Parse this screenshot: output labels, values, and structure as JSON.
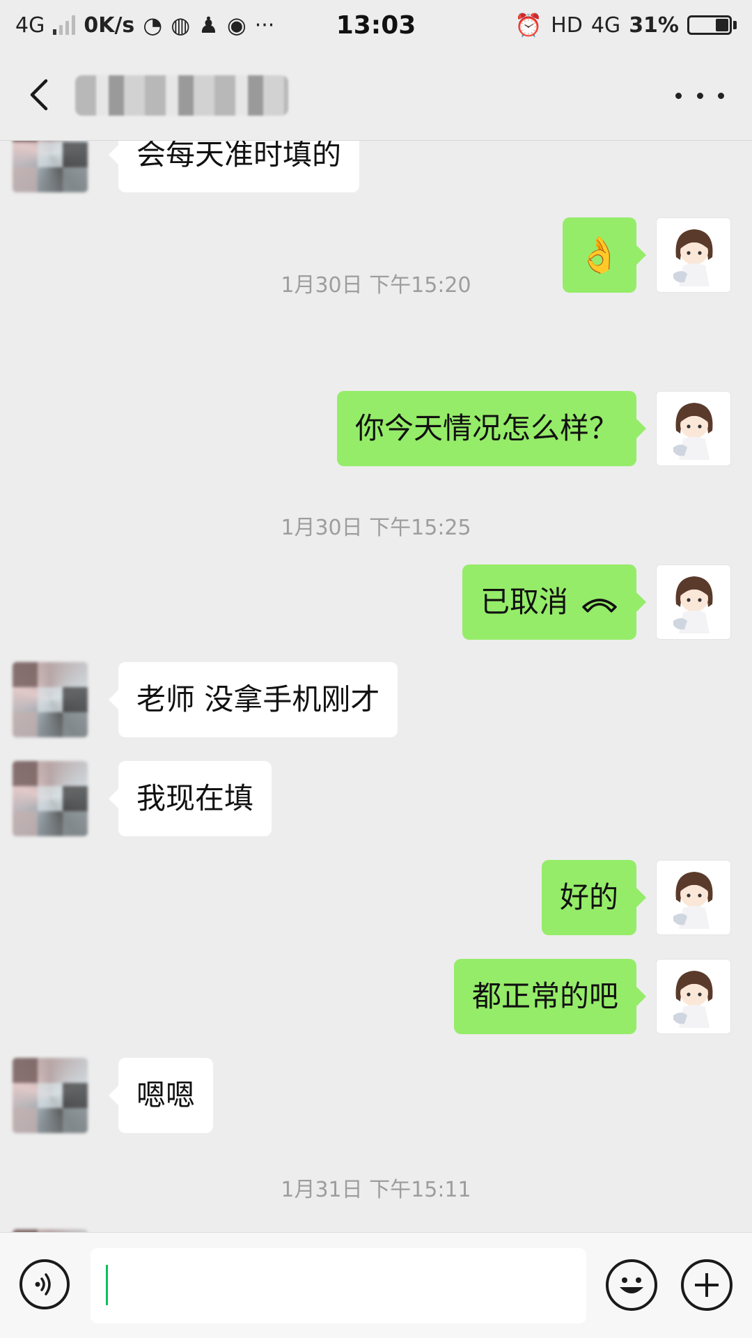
{
  "status_bar": {
    "network_left": "4G",
    "speed": "0K/s",
    "time": "13:03",
    "hd": "HD",
    "network_right": "4G",
    "battery_percent": "31%",
    "battery_level": 0.31,
    "more": "···"
  },
  "header": {
    "title": "",
    "back_icon": "chevron-left-icon",
    "more_icon": "more-dots-icon"
  },
  "messages": [
    {
      "sender": "them",
      "text": "会每天准时填的"
    },
    {
      "sender": "me",
      "type": "emoji",
      "text": "👌"
    },
    {
      "type": "timestamp",
      "text": "1月30日 下午15:20"
    },
    {
      "sender": "me",
      "text": "你今天情况怎么样？"
    },
    {
      "type": "timestamp",
      "text": "1月30日 下午15:25"
    },
    {
      "sender": "me",
      "type": "call",
      "text": "已取消"
    },
    {
      "sender": "them",
      "text": "老师 没拿手机刚才"
    },
    {
      "sender": "them",
      "text": "我现在填"
    },
    {
      "sender": "me",
      "text": "好的"
    },
    {
      "sender": "me",
      "text": "都正常的吧"
    },
    {
      "sender": "them",
      "text": "嗯嗯"
    },
    {
      "type": "timestamp",
      "text": "1月31日 下午15:11"
    }
  ],
  "input_bar": {
    "value": "",
    "voice_icon": "voice-icon",
    "emoji_icon": "emoji-icon",
    "plus_icon": "plus-icon"
  }
}
